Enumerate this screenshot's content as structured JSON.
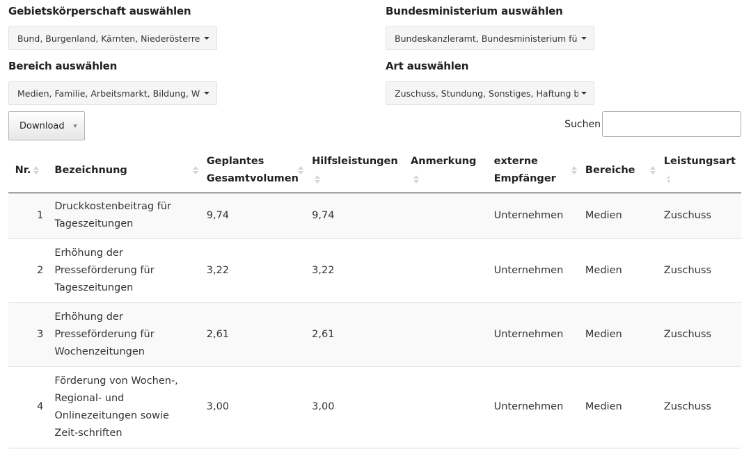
{
  "filters": [
    {
      "label": "Gebietskörperschaft auswählen",
      "value": "Bund, Burgenland, Kärnten, Niederösterre"
    },
    {
      "label": "Bundesministerium auswählen",
      "value": "Bundeskanzleramt, Bundesministerium fü"
    },
    {
      "label": "Bereich auswählen",
      "value": "Medien, Familie, Arbeitsmarkt, Bildung, W"
    },
    {
      "label": "Art auswählen",
      "value": "Zuschuss, Stundung, Sonstiges, Haftung b"
    }
  ],
  "toolbar": {
    "download_label": "Download",
    "search_label": "Suchen",
    "search_value": ""
  },
  "table": {
    "columns": [
      "Nr.",
      "Bezeichnung",
      "Geplantes Gesamtvolumen",
      "Hilfsleistungen",
      "Anmerkung",
      "externe Empfänger",
      "Bereiche",
      "Leistungsart"
    ],
    "rows": [
      {
        "nr": "1",
        "bezeichnung": "Druckkostenbeitrag für Tageszeitungen",
        "gesamtvolumen": "9,74",
        "hilfsleistungen": "9,74",
        "anmerkung": "",
        "empfaenger": "Unternehmen",
        "bereiche": "Medien",
        "leistungsart": "Zuschuss"
      },
      {
        "nr": "2",
        "bezeichnung": "Erhöhung der Presseförderung für Tageszeitungen",
        "gesamtvolumen": "3,22",
        "hilfsleistungen": "3,22",
        "anmerkung": "",
        "empfaenger": "Unternehmen",
        "bereiche": "Medien",
        "leistungsart": "Zuschuss"
      },
      {
        "nr": "3",
        "bezeichnung": "Erhöhung der Presseförderung für Wochenzeitungen",
        "gesamtvolumen": "2,61",
        "hilfsleistungen": "2,61",
        "anmerkung": "",
        "empfaenger": "Unternehmen",
        "bereiche": "Medien",
        "leistungsart": "Zuschuss"
      },
      {
        "nr": "4",
        "bezeichnung": "Förderung von Wochen-, Regional- und Onlinezeitungen sowie Zeit-schriften",
        "gesamtvolumen": "3,00",
        "hilfsleistungen": "3,00",
        "anmerkung": "",
        "empfaenger": "Unternehmen",
        "bereiche": "Medien",
        "leistungsart": "Zuschuss"
      }
    ]
  }
}
